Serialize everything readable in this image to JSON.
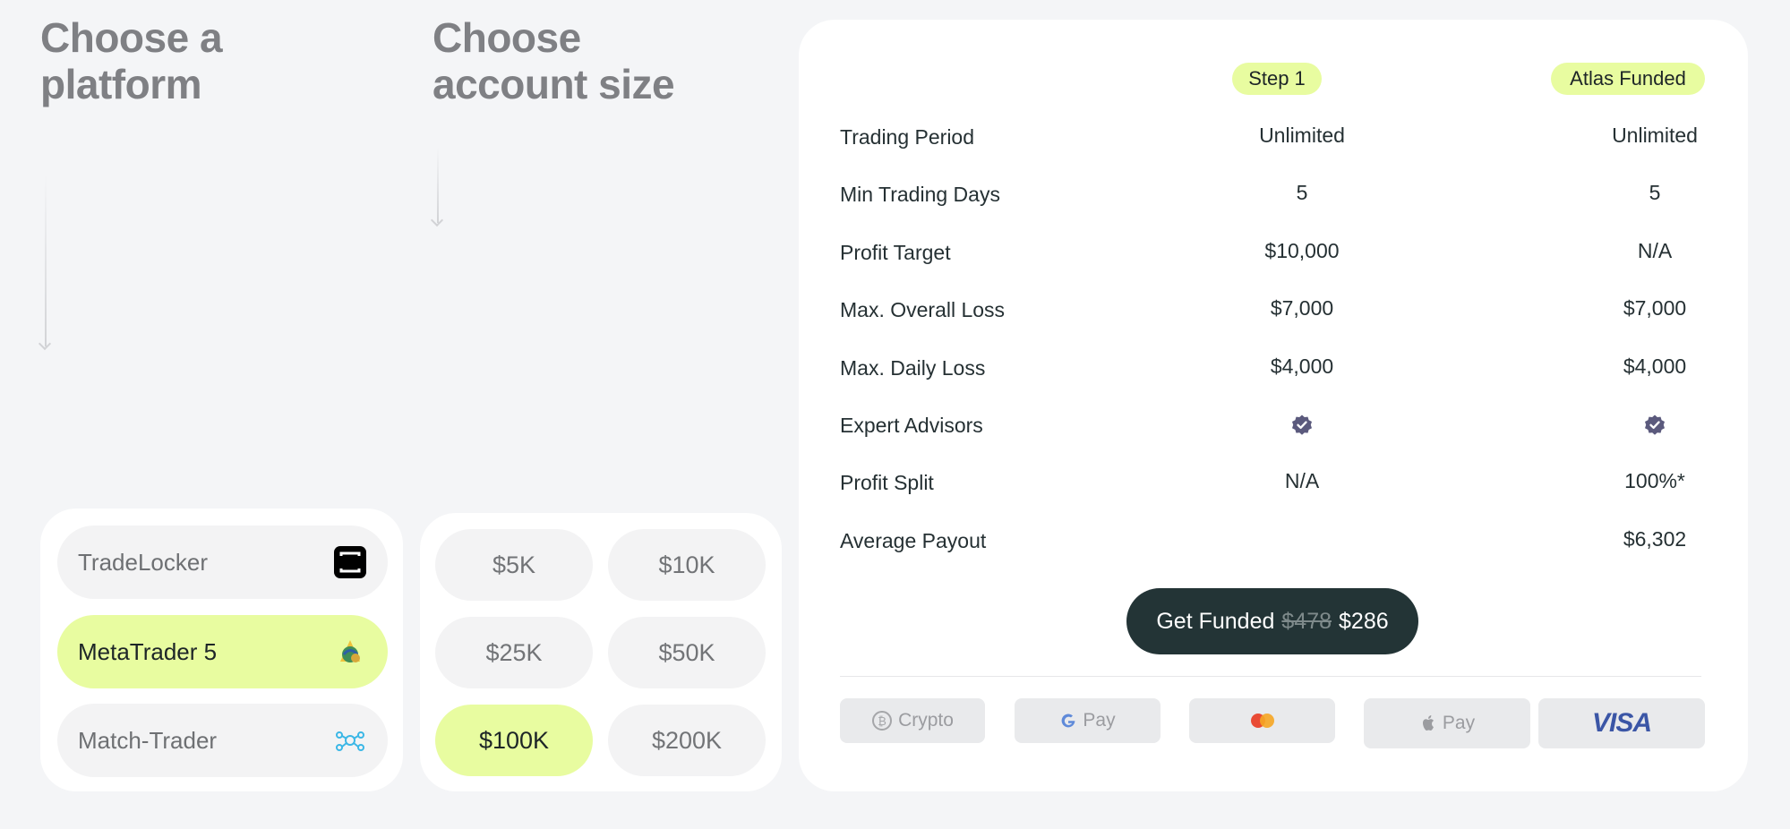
{
  "headings": {
    "platform": "Choose a\nplatform",
    "size": "Choose\naccount size"
  },
  "platforms": [
    {
      "label": "TradeLocker",
      "icon": "tradelocker-icon",
      "selected": false
    },
    {
      "label": "MetaTrader 5",
      "icon": "metatrader-icon",
      "selected": true
    },
    {
      "label": "Match-Trader",
      "icon": "match-trader-icon",
      "selected": false
    }
  ],
  "sizes": [
    {
      "label": "$5K",
      "selected": false
    },
    {
      "label": "$10K",
      "selected": false
    },
    {
      "label": "$25K",
      "selected": false
    },
    {
      "label": "$50K",
      "selected": false
    },
    {
      "label": "$100K",
      "selected": true
    },
    {
      "label": "$200K",
      "selected": false
    }
  ],
  "compare": {
    "columns": [
      "Step 1",
      "Atlas Funded"
    ],
    "rows": [
      {
        "label": "Trading Period",
        "v1": "Unlimited",
        "v2": "Unlimited"
      },
      {
        "label": "Min Trading Days",
        "v1": "5",
        "v2": "5"
      },
      {
        "label": "Profit Target",
        "v1": "$10,000",
        "v2": "N/A"
      },
      {
        "label": "Max. Overall Loss",
        "v1": "$7,000",
        "v2": "$7,000"
      },
      {
        "label": "Max. Daily Loss",
        "v1": "$4,000",
        "v2": "$4,000"
      },
      {
        "label": "Expert Advisors",
        "v1": "",
        "v2": "",
        "icon": "verified-check-icon"
      },
      {
        "label": "Profit Split",
        "v1": "N/A",
        "v2": "100%*"
      },
      {
        "label": "Average Payout",
        "v1": "",
        "v2": "$6,302"
      }
    ]
  },
  "cta": {
    "label": "Get Funded",
    "old_price": "$478",
    "new_price": "$286"
  },
  "payments": [
    {
      "label": "Crypto",
      "icon": "bitcoin-icon"
    },
    {
      "label": "Pay",
      "icon": "google-icon"
    },
    {
      "label": "",
      "icon": "mastercard-icon"
    },
    {
      "label": "Pay",
      "icon": "apple-icon"
    },
    {
      "label": "VISA",
      "icon": "visa-logo"
    }
  ],
  "colors": {
    "accent": "#e8fca0",
    "cta_bg": "#233436",
    "check": "#5b5a7d"
  }
}
